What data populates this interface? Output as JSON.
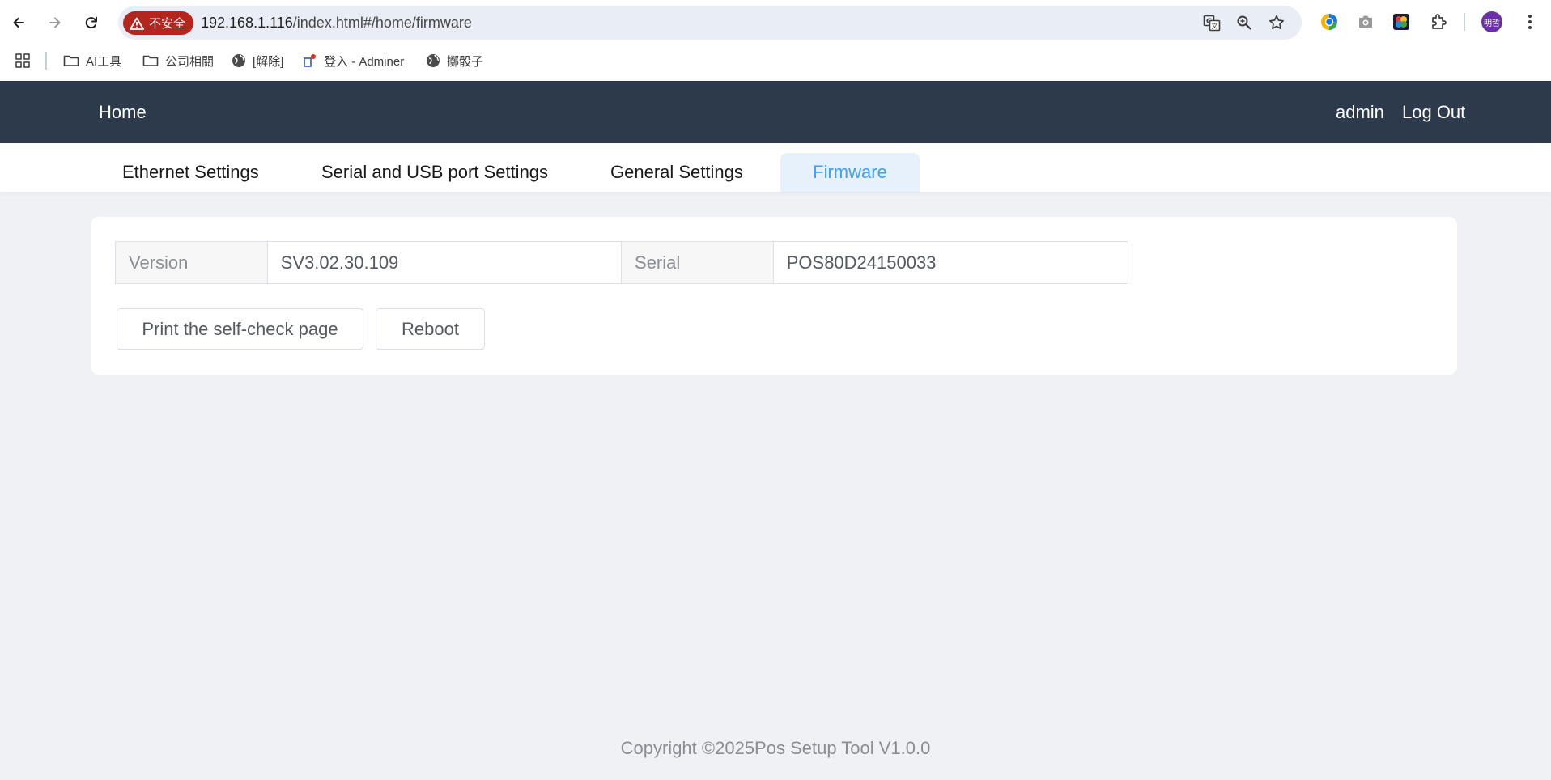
{
  "browser": {
    "insecure_label": "不安全",
    "url_host": "192.168.1.116",
    "url_path": "/index.html#/home/firmware",
    "profile_initials": "明哲"
  },
  "bookmarks": [
    {
      "label": "AI工具",
      "icon": "folder-icon"
    },
    {
      "label": "公司相關",
      "icon": "folder-icon"
    },
    {
      "label": "[解除]",
      "icon": "globe-icon"
    },
    {
      "label": "登入 - Adminer",
      "icon": "adminer-icon"
    },
    {
      "label": "擲骰子",
      "icon": "globe-icon"
    }
  ],
  "header": {
    "home": "Home",
    "user": "admin",
    "logout": "Log Out"
  },
  "tabs": [
    {
      "label": "Ethernet Settings",
      "active": false
    },
    {
      "label": "Serial and USB port Settings",
      "active": false
    },
    {
      "label": "General Settings",
      "active": false
    },
    {
      "label": "Firmware",
      "active": true
    }
  ],
  "firmware": {
    "version_label": "Version",
    "version_value": "SV3.02.30.109",
    "serial_label": "Serial",
    "serial_value": "POS80D24150033",
    "print_button": "Print the self-check page",
    "reboot_button": "Reboot"
  },
  "footer": "Copyright ©2025Pos Setup Tool V1.0.0",
  "colors": {
    "header_bg": "#2d3a4b",
    "accent": "#409eff",
    "active_tab_bg": "#e6f1fc",
    "page_bg": "#eff1f5",
    "insecure": "#b3261e"
  }
}
